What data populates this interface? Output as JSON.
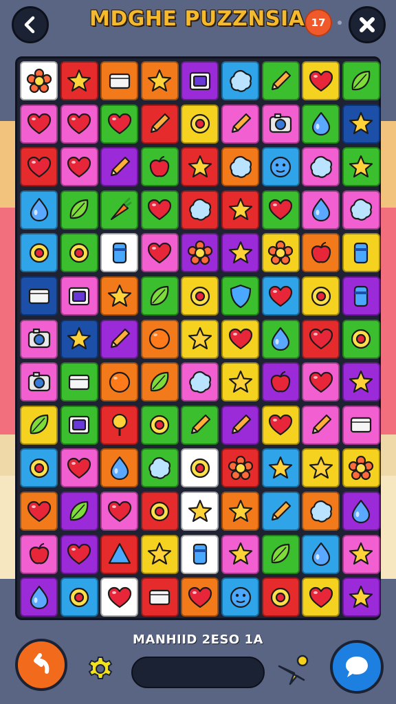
{
  "header": {
    "title": "MDGHE PUZZNSIA",
    "counter": "17",
    "back_icon": "chevron-left-icon",
    "close_icon": "close-icon"
  },
  "background_stripes": [
    {
      "color": "#f2c37c"
    },
    {
      "color": "#f26f7e"
    },
    {
      "color": "#f0d9a8"
    },
    {
      "color": "#f7e7c0"
    }
  ],
  "board": {
    "rows": 13,
    "cols": 9,
    "tiles": [
      [
        {
          "bg": "#ffffff",
          "icon": "flower"
        },
        {
          "bg": "#e52b2b",
          "icon": "star"
        },
        {
          "bg": "#f27a1a",
          "icon": "box"
        },
        {
          "bg": "#f27a1a",
          "icon": "star"
        },
        {
          "bg": "#9b2ad8",
          "icon": "tv"
        },
        {
          "bg": "#2fa4e8",
          "icon": "blob"
        },
        {
          "bg": "#3bbf2f",
          "icon": "pencil"
        },
        {
          "bg": "#f5d21f",
          "icon": "heart"
        },
        {
          "bg": "#3bbf2f",
          "icon": "leaf"
        }
      ],
      [
        {
          "bg": "#f25fd0",
          "icon": "heart"
        },
        {
          "bg": "#f25fd0",
          "icon": "heart"
        },
        {
          "bg": "#3bbf2f",
          "icon": "heart"
        },
        {
          "bg": "#e52b2b",
          "icon": "pencil"
        },
        {
          "bg": "#f5d21f",
          "icon": "ring"
        },
        {
          "bg": "#f25fd0",
          "icon": "pencil"
        },
        {
          "bg": "#f25fd0",
          "icon": "camera"
        },
        {
          "bg": "#3bbf2f",
          "icon": "drop"
        },
        {
          "bg": "#1b4fa8",
          "icon": "star"
        }
      ],
      [
        {
          "bg": "#e52b2b",
          "icon": "heart"
        },
        {
          "bg": "#f25fd0",
          "icon": "heart"
        },
        {
          "bg": "#9b2ad8",
          "icon": "pencil"
        },
        {
          "bg": "#3bbf2f",
          "icon": "apple"
        },
        {
          "bg": "#e52b2b",
          "icon": "star"
        },
        {
          "bg": "#f27a1a",
          "icon": "blob"
        },
        {
          "bg": "#2fa4e8",
          "icon": "face"
        },
        {
          "bg": "#f25fd0",
          "icon": "blob"
        },
        {
          "bg": "#3bbf2f",
          "icon": "star"
        }
      ],
      [
        {
          "bg": "#2fa4e8",
          "icon": "drop"
        },
        {
          "bg": "#3bbf2f",
          "icon": "leaf"
        },
        {
          "bg": "#3bbf2f",
          "icon": "carrot"
        },
        {
          "bg": "#3bbf2f",
          "icon": "heart"
        },
        {
          "bg": "#e52b2b",
          "icon": "blob"
        },
        {
          "bg": "#e52b2b",
          "icon": "star"
        },
        {
          "bg": "#3bbf2f",
          "icon": "heart"
        },
        {
          "bg": "#f25fd0",
          "icon": "drop"
        },
        {
          "bg": "#f25fd0",
          "icon": "blob"
        }
      ],
      [
        {
          "bg": "#2fa4e8",
          "icon": "ring"
        },
        {
          "bg": "#3bbf2f",
          "icon": "ring"
        },
        {
          "bg": "#ffffff",
          "icon": "can"
        },
        {
          "bg": "#f25fd0",
          "icon": "heart"
        },
        {
          "bg": "#9b2ad8",
          "icon": "flower"
        },
        {
          "bg": "#9b2ad8",
          "icon": "star"
        },
        {
          "bg": "#f5d21f",
          "icon": "flower"
        },
        {
          "bg": "#f27a1a",
          "icon": "apple"
        },
        {
          "bg": "#f5d21f",
          "icon": "can"
        }
      ],
      [
        {
          "bg": "#1b4fa8",
          "icon": "box"
        },
        {
          "bg": "#f25fd0",
          "icon": "tv"
        },
        {
          "bg": "#f27a1a",
          "icon": "star"
        },
        {
          "bg": "#3bbf2f",
          "icon": "leaf"
        },
        {
          "bg": "#f5d21f",
          "icon": "ring"
        },
        {
          "bg": "#3bbf2f",
          "icon": "shield"
        },
        {
          "bg": "#2fa4e8",
          "icon": "heart"
        },
        {
          "bg": "#f5d21f",
          "icon": "ring"
        },
        {
          "bg": "#9b2ad8",
          "icon": "can"
        }
      ],
      [
        {
          "bg": "#f25fd0",
          "icon": "camera"
        },
        {
          "bg": "#1b4fa8",
          "icon": "star"
        },
        {
          "bg": "#9b2ad8",
          "icon": "pencil"
        },
        {
          "bg": "#f27a1a",
          "icon": "circle"
        },
        {
          "bg": "#f5d21f",
          "icon": "star"
        },
        {
          "bg": "#f5d21f",
          "icon": "heart"
        },
        {
          "bg": "#3bbf2f",
          "icon": "drop"
        },
        {
          "bg": "#e52b2b",
          "icon": "heart"
        },
        {
          "bg": "#3bbf2f",
          "icon": "ring"
        }
      ],
      [
        {
          "bg": "#f25fd0",
          "icon": "camera"
        },
        {
          "bg": "#3bbf2f",
          "icon": "box"
        },
        {
          "bg": "#f27a1a",
          "icon": "circle"
        },
        {
          "bg": "#f27a1a",
          "icon": "leaf"
        },
        {
          "bg": "#f25fd0",
          "icon": "blob"
        },
        {
          "bg": "#f5d21f",
          "icon": "star"
        },
        {
          "bg": "#9b2ad8",
          "icon": "apple"
        },
        {
          "bg": "#f25fd0",
          "icon": "heart"
        },
        {
          "bg": "#9b2ad8",
          "icon": "star"
        }
      ],
      [
        {
          "bg": "#f5d21f",
          "icon": "leaf"
        },
        {
          "bg": "#3bbf2f",
          "icon": "tv"
        },
        {
          "bg": "#e52b2b",
          "icon": "lolly"
        },
        {
          "bg": "#3bbf2f",
          "icon": "ring"
        },
        {
          "bg": "#3bbf2f",
          "icon": "pencil"
        },
        {
          "bg": "#9b2ad8",
          "icon": "pencil"
        },
        {
          "bg": "#f5d21f",
          "icon": "heart"
        },
        {
          "bg": "#f25fd0",
          "icon": "pencil"
        },
        {
          "bg": "#f25fd0",
          "icon": "box"
        }
      ],
      [
        {
          "bg": "#2fa4e8",
          "icon": "ring"
        },
        {
          "bg": "#f25fd0",
          "icon": "heart"
        },
        {
          "bg": "#f27a1a",
          "icon": "drop"
        },
        {
          "bg": "#3bbf2f",
          "icon": "blob"
        },
        {
          "bg": "#ffffff",
          "icon": "ring"
        },
        {
          "bg": "#e52b2b",
          "icon": "flower"
        },
        {
          "bg": "#2fa4e8",
          "icon": "star"
        },
        {
          "bg": "#f5d21f",
          "icon": "star"
        },
        {
          "bg": "#f5d21f",
          "icon": "flower"
        }
      ],
      [
        {
          "bg": "#f27a1a",
          "icon": "heart"
        },
        {
          "bg": "#9b2ad8",
          "icon": "leaf"
        },
        {
          "bg": "#f25fd0",
          "icon": "heart"
        },
        {
          "bg": "#e52b2b",
          "icon": "ring"
        },
        {
          "bg": "#ffffff",
          "icon": "star"
        },
        {
          "bg": "#f27a1a",
          "icon": "star"
        },
        {
          "bg": "#2fa4e8",
          "icon": "pencil"
        },
        {
          "bg": "#f27a1a",
          "icon": "blob"
        },
        {
          "bg": "#9b2ad8",
          "icon": "drop"
        }
      ],
      [
        {
          "bg": "#f25fd0",
          "icon": "apple"
        },
        {
          "bg": "#9b2ad8",
          "icon": "heart"
        },
        {
          "bg": "#e52b2b",
          "icon": "triangle"
        },
        {
          "bg": "#f5d21f",
          "icon": "star"
        },
        {
          "bg": "#ffffff",
          "icon": "can"
        },
        {
          "bg": "#f25fd0",
          "icon": "star"
        },
        {
          "bg": "#3bbf2f",
          "icon": "leaf"
        },
        {
          "bg": "#2fa4e8",
          "icon": "drop"
        },
        {
          "bg": "#f25fd0",
          "icon": "star"
        }
      ],
      [
        {
          "bg": "#9b2ad8",
          "icon": "drop"
        },
        {
          "bg": "#2fa4e8",
          "icon": "ring"
        },
        {
          "bg": "#ffffff",
          "icon": "heart"
        },
        {
          "bg": "#e52b2b",
          "icon": "box"
        },
        {
          "bg": "#f27a1a",
          "icon": "heart"
        },
        {
          "bg": "#2fa4e8",
          "icon": "face"
        },
        {
          "bg": "#e52b2b",
          "icon": "ring"
        },
        {
          "bg": "#f5d21f",
          "icon": "heart"
        },
        {
          "bg": "#9b2ad8",
          "icon": "star"
        }
      ]
    ]
  },
  "footer": {
    "status_text": "MANHIID 2ESO 1A",
    "undo_icon": "undo-icon",
    "settings_icon": "gear-icon",
    "hint_icon": "hint-icon",
    "chat_icon": "chat-bubble-icon",
    "progress": 0.0
  },
  "colors": {
    "background": "#5a6584",
    "title": "#f4b92c",
    "board": "#1e2233",
    "undo": "#f26a1b",
    "chat": "#1d7fe0",
    "counter": "#f0592a"
  }
}
